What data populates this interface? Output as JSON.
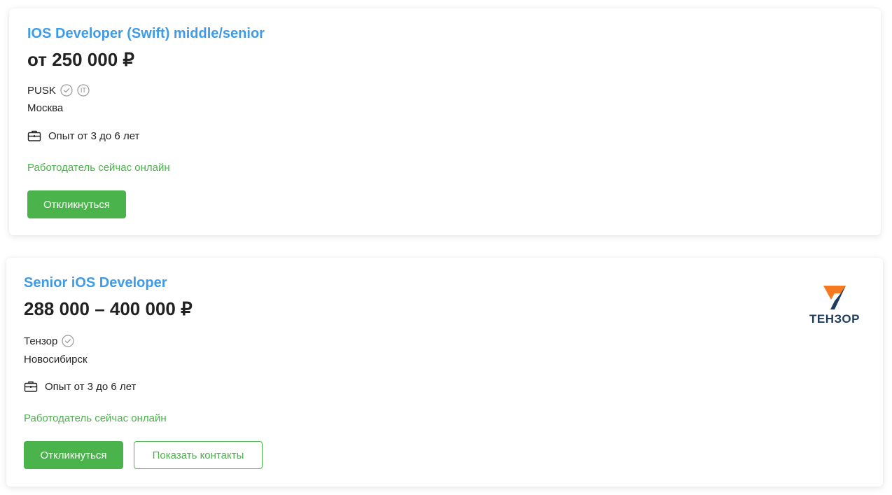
{
  "vacancies": [
    {
      "title": "IOS Developer (Swift) middle/senior",
      "salary": "от 250 000 ₽",
      "company": "PUSK",
      "badges": [
        "check-circle-icon",
        "it-accredited-icon"
      ],
      "badge_it_text": "IT",
      "city": "Москва",
      "experience": "Опыт от 3 до 6 лет",
      "online_status": "Работодатель сейчас онлайн",
      "respond_label": "Откликнуться"
    },
    {
      "title": "Senior iOS Developer",
      "salary": "288 000 – 400 000 ₽",
      "company": "Тензор",
      "badges": [
        "check-circle-icon"
      ],
      "city": "Новосибирск",
      "experience": "Опыт от 3 до 6 лет",
      "online_status": "Работодатель сейчас онлайн",
      "respond_label": "Откликнуться",
      "contacts_label": "Показать контакты",
      "logo_text": "ТЕНЗОР"
    }
  ],
  "colors": {
    "title": "#3d9be9",
    "accent_green": "#4bb34b",
    "text": "#222222",
    "logo_orange": "#f47920",
    "logo_navy": "#1d3c5e"
  }
}
